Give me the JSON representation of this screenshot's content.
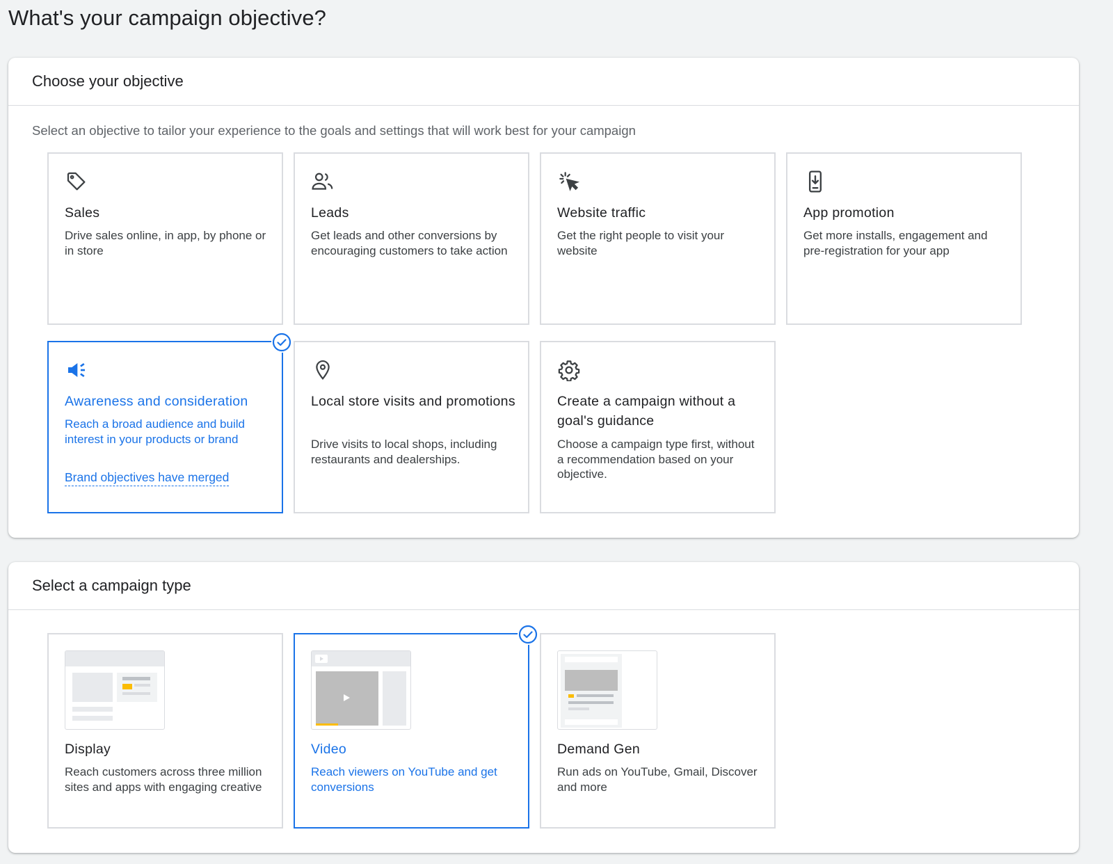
{
  "page": {
    "title": "What's your campaign objective?"
  },
  "objective_panel": {
    "heading": "Choose your objective",
    "description": "Select an objective to tailor your experience to the goals and settings that will work best for your campaign",
    "cards": [
      {
        "title": "Sales",
        "desc": "Drive sales online, in app, by phone or in store",
        "icon": "tag-icon",
        "selected": false
      },
      {
        "title": "Leads",
        "desc": "Get leads and other conversions by encouraging customers to take action",
        "icon": "people-icon",
        "selected": false
      },
      {
        "title": "Website traffic",
        "desc": "Get the right people to visit your website",
        "icon": "cursor-click-icon",
        "selected": false
      },
      {
        "title": "App promotion",
        "desc": "Get more installs, engagement and pre-registration for your app",
        "icon": "phone-download-icon",
        "selected": false
      },
      {
        "title": "Awareness and consideration",
        "desc": "Reach a broad audience and build interest in your products or brand",
        "link": "Brand objectives have merged",
        "icon": "megaphone-icon",
        "selected": true
      },
      {
        "title": "Local store visits and promotions",
        "desc": "Drive visits to local shops, including restaurants and dealerships.",
        "icon": "location-pin-icon",
        "selected": false
      },
      {
        "title": "Create a campaign without a goal's guidance",
        "desc": "Choose a campaign type first, without a recommendation based on your objective.",
        "icon": "gear-icon",
        "selected": false
      }
    ]
  },
  "type_panel": {
    "heading": "Select a campaign type",
    "cards": [
      {
        "title": "Display",
        "desc": "Reach customers across three million sites and apps with engaging creative",
        "thumb": "display-thumbnail",
        "selected": false
      },
      {
        "title": "Video",
        "desc": "Reach viewers on YouTube and get conversions",
        "thumb": "video-thumbnail",
        "selected": true
      },
      {
        "title": "Demand Gen",
        "desc": "Run ads on YouTube, Gmail, Discover and more",
        "thumb": "demand-gen-thumbnail",
        "selected": false
      }
    ]
  },
  "colors": {
    "accent": "#1a73e8",
    "border": "#dadce0",
    "background": "#f1f3f4",
    "highlight": "#fbbc04"
  }
}
